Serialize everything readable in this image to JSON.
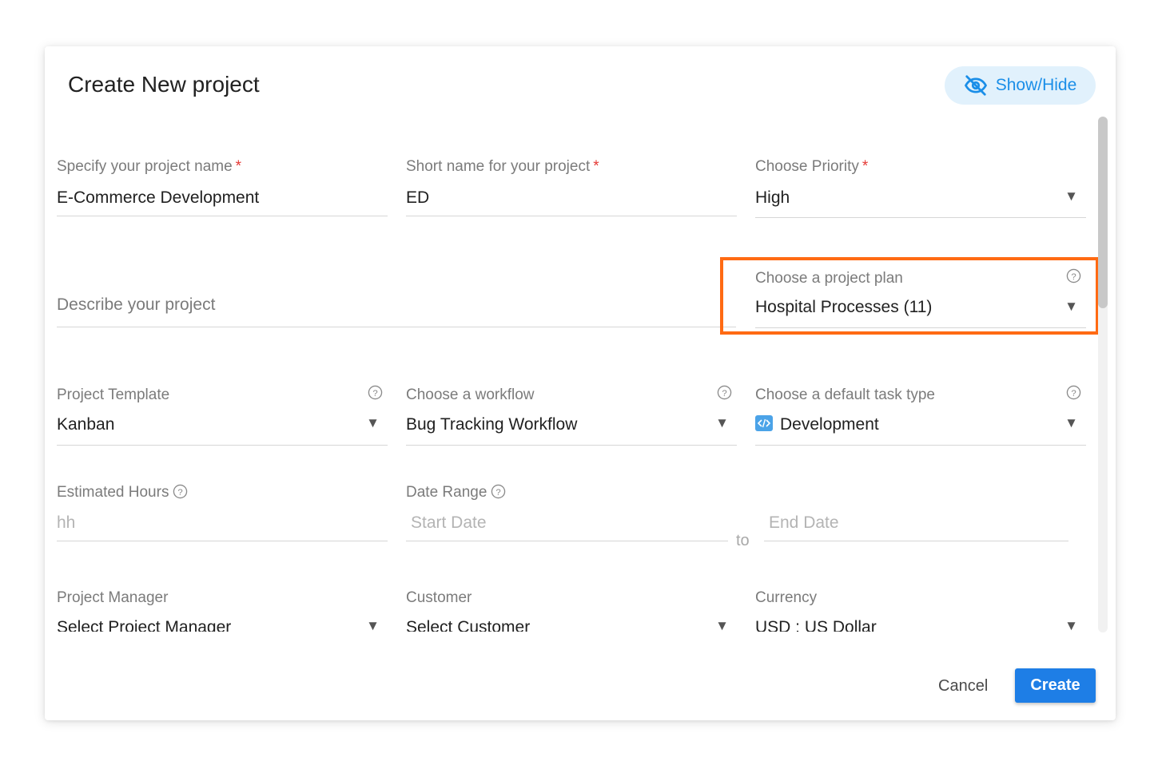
{
  "dialog": {
    "title": "Create New project",
    "show_hide_label": "Show/Hide",
    "show_hide_icon": "eye-off-icon",
    "accent_color": "#1e7ee6",
    "highlight_color": "#ff6a13"
  },
  "fields": {
    "project_name": {
      "label": "Specify your project name",
      "required_mark": "*",
      "value": "E-Commerce Development"
    },
    "short_name": {
      "label": "Short name for your project",
      "required_mark": "*",
      "value": "ED"
    },
    "priority": {
      "label": "Choose Priority",
      "required_mark": "*",
      "value": "High"
    },
    "description": {
      "placeholder": "Describe your project"
    },
    "project_plan": {
      "label": "Choose a project plan",
      "value": "Hospital Processes (11)"
    },
    "template": {
      "label": "Project Template",
      "value": "Kanban"
    },
    "workflow": {
      "label": "Choose a workflow",
      "value": "Bug Tracking Workflow"
    },
    "task_type": {
      "label": "Choose a default task type",
      "value": "Development",
      "icon": "code-icon"
    },
    "estimated_hours": {
      "label": "Estimated Hours",
      "placeholder": "hh"
    },
    "date_range": {
      "label": "Date Range",
      "start_placeholder": "Start Date",
      "separator": "to",
      "end_placeholder": "End Date"
    },
    "project_manager": {
      "label": "Project Manager",
      "value": "Select Project Manager"
    },
    "customer": {
      "label": "Customer",
      "value": "Select Customer"
    },
    "currency": {
      "label": "Currency",
      "value": "USD : US Dollar"
    }
  },
  "actions": {
    "cancel_label": "Cancel",
    "create_label": "Create"
  }
}
